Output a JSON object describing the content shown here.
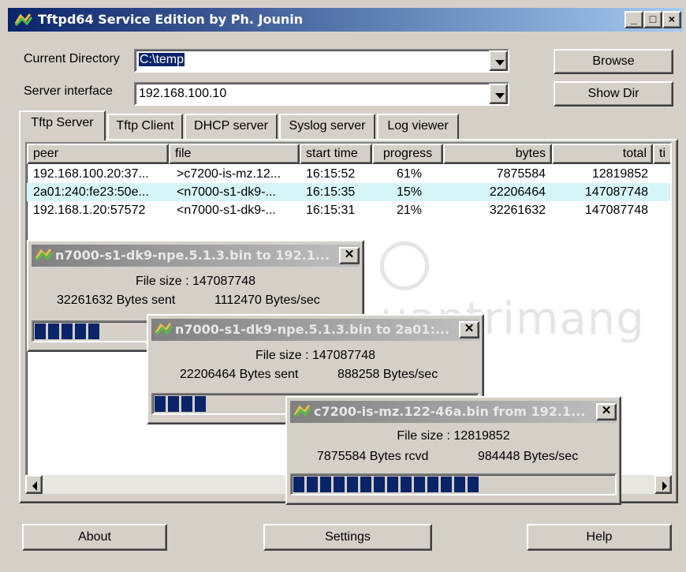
{
  "window": {
    "title": "Tftpd64 Service Edition by Ph. Jounin",
    "minimize": "_",
    "maximize": "□",
    "close": "×"
  },
  "current_directory": {
    "label": "Current Directory",
    "value": "C:\\temp"
  },
  "server_interface": {
    "label": "Server interface",
    "value": "192.168.100.10"
  },
  "buttons": {
    "browse": "Browse",
    "show_dir": "Show Dir",
    "about": "About",
    "settings": "Settings",
    "help": "Help"
  },
  "tabs": [
    "Tftp Server",
    "Tftp Client",
    "DHCP server",
    "Syslog server",
    "Log viewer"
  ],
  "active_tab": "Tftp Server",
  "columns": [
    "peer",
    "file",
    "start time",
    "progress",
    "bytes",
    "total",
    "ti"
  ],
  "transfers": [
    {
      "peer": "192.168.100.20:37...",
      "file": ">c7200-is-mz.12...",
      "start_time": "16:15:52",
      "progress": "61%",
      "bytes": "7875584",
      "total": "12819852"
    },
    {
      "peer": "2a01:240:fe23:50e...",
      "file": "<n7000-s1-dk9-...",
      "start_time": "16:15:35",
      "progress": "15%",
      "bytes": "22206464",
      "total": "147087748"
    },
    {
      "peer": "192.168.1.20:57572",
      "file": "<n7000-s1-dk9-...",
      "start_time": "16:15:31",
      "progress": "21%",
      "bytes": "32261632",
      "total": "147087748"
    }
  ],
  "highlight_color": "#d6f5f8",
  "watermark": "uantrimang",
  "dialogs": [
    {
      "title": "n7000-s1-dk9-npe.5.1.3.bin to 192.1...",
      "file_size": "File size : 147087748",
      "bytes": "32261632 Bytes sent",
      "rate": "1112470 Bytes/sec",
      "progress": 0.21
    },
    {
      "title": "n7000-s1-dk9-npe.5.1.3.bin to 2a01:...",
      "file_size": "File size : 147087748",
      "bytes": "22206464 Bytes sent",
      "rate": "888258 Bytes/sec",
      "progress": 0.15
    },
    {
      "title": "c7200-is-mz.122-46a.bin from 192.1...",
      "file_size": "File size : 12819852",
      "bytes": "7875584 Bytes rcvd",
      "rate": "984448 Bytes/sec",
      "progress": 0.61
    }
  ],
  "dialog_close": "✕",
  "icons": {
    "app": "tftpd-app-icon",
    "dialog": "tftpd-transfer-icon"
  },
  "colors": {
    "title_active": "#0a246a",
    "progress_fill": "#0a246a",
    "face": "#d4d0c8"
  }
}
